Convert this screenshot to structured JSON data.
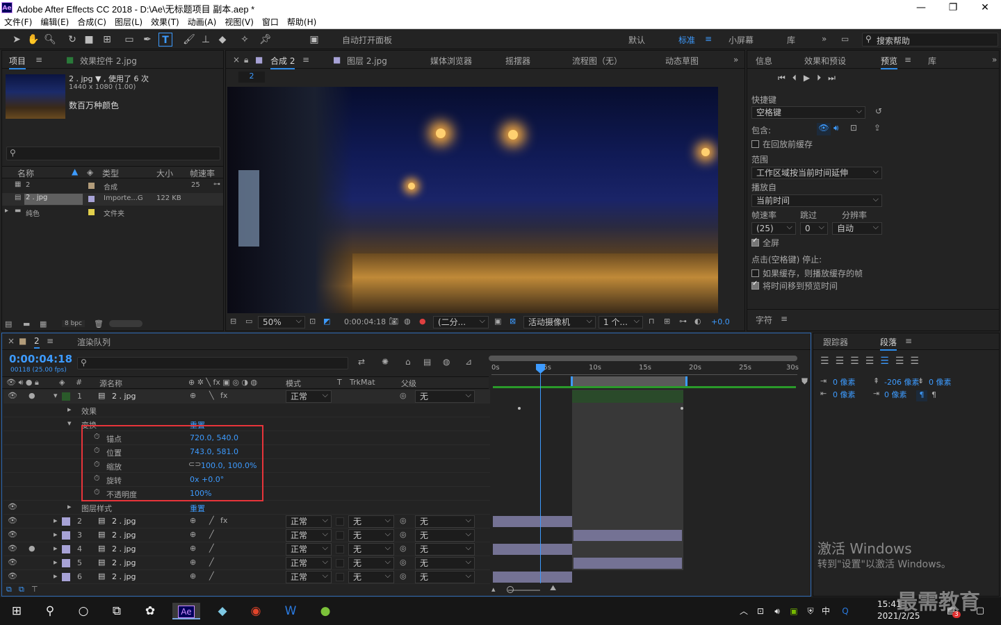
{
  "window": {
    "title": "Adobe After Effects CC 2018 - D:\\Ae\\无标题项目 副本.aep *",
    "app_icon": "Ae"
  },
  "menu": [
    "文件(F)",
    "编辑(E)",
    "合成(C)",
    "图层(L)",
    "效果(T)",
    "动画(A)",
    "视图(V)",
    "窗口",
    "帮助(H)"
  ],
  "toolbar": {
    "auto_open": "自动打开面板",
    "workspaces": [
      "默认",
      "标准",
      "小屏幕",
      "库"
    ],
    "search_placeholder": "搜索帮助"
  },
  "project": {
    "tab1": "项目",
    "tab2": "效果控件 2.jpg",
    "file": "2 . jpg ▼ , 使用了 6 次",
    "dims": "1440 x 1080 (1.00)",
    "colors": "数百万种颜色",
    "headers": [
      "名称",
      "类型",
      "大小",
      "帧速率"
    ],
    "items": [
      {
        "name": "2",
        "type": "合成",
        "size": "",
        "fps": "25"
      },
      {
        "name": "2 . jpg",
        "type": "Importe...G",
        "size": "122 KB",
        "fps": ""
      },
      {
        "name": "纯色",
        "type": "文件夹",
        "size": "",
        "fps": ""
      }
    ],
    "bpc": "8 bpc"
  },
  "viewer": {
    "tabs": [
      "合成 2",
      "图层 2.jpg",
      "媒体浏览器",
      "摇摆器",
      "流程图（无）",
      "动态草图"
    ],
    "crumb": "2",
    "zoom": "50%",
    "time": "0:00:04:18",
    "res": "(二分...",
    "camera": "活动摄像机",
    "views": "1 个...",
    "exposure": "+0.0"
  },
  "preview": {
    "tabs": [
      "信息",
      "效果和预设",
      "预览",
      "库"
    ],
    "shortcut_label": "快捷键",
    "shortcut": "空格键",
    "include": "包含:",
    "cache_before": "在回放前缓存",
    "range_label": "范围",
    "range": "工作区域按当前时间延伸",
    "play_from_label": "播放自",
    "play_from": "当前时间",
    "fps_label": "帧速率",
    "skip_label": "跳过",
    "res_label": "分辨率",
    "fps": "(25)",
    "skip": "0",
    "res": "自动",
    "fullscreen": "全屏",
    "stop_label": "点击(空格键) 停止:",
    "if_cached": "如果缓存，则播放缓存的帧",
    "move_time": "将时间移到预览时间",
    "char_tab": "字符"
  },
  "timeline": {
    "tab": "2",
    "render_queue": "渲染队列",
    "timecode": "0:00:04:18",
    "frames": "00118 (25.00 fps)",
    "headers": {
      "source": "源名称",
      "mode": "模式",
      "t": "T",
      "trkmat": "TrkMat",
      "parent": "父级"
    },
    "ruler": [
      "0s",
      "05s",
      "10s",
      "15s",
      "20s",
      "25s",
      "30s"
    ],
    "layer1": {
      "num": "1",
      "name": "2 . jpg",
      "mode": "正常",
      "parent": "无"
    },
    "effects": "效果",
    "transform": "变换",
    "reset": "重置",
    "props": [
      {
        "name": "锚点",
        "value": "720.0, 540.0"
      },
      {
        "name": "位置",
        "value": "743.0, 581.0"
      },
      {
        "name": "缩放",
        "value": "100.0, 100.0%"
      },
      {
        "name": "旋转",
        "value": "0x +0.0°"
      },
      {
        "name": "不透明度",
        "value": "100%"
      }
    ],
    "layer_styles": "图层样式",
    "reset2": "重置",
    "layers": [
      {
        "num": "2",
        "name": "2 . jpg",
        "mode": "正常",
        "trk": "无",
        "parent": "无"
      },
      {
        "num": "3",
        "name": "2 . jpg",
        "mode": "正常",
        "trk": "无",
        "parent": "无"
      },
      {
        "num": "4",
        "name": "2 . jpg",
        "mode": "正常",
        "trk": "无",
        "parent": "无"
      },
      {
        "num": "5",
        "name": "2 . jpg",
        "mode": "正常",
        "trk": "无",
        "parent": "无"
      },
      {
        "num": "6",
        "name": "2 . jpg",
        "mode": "正常",
        "trk": "无",
        "parent": "无"
      }
    ]
  },
  "paragraph": {
    "tabs": [
      "跟踪器",
      "段落"
    ],
    "indent_left": "0 像素",
    "indent_right": "0 像素",
    "first_indent": "-206 像素",
    "space_before": "0 像素",
    "space_after": "0 像素"
  },
  "watermark": {
    "line1": "激活 Windows",
    "line2": "转到\"设置\"以激活 Windows。",
    "brand": "最需教育"
  },
  "taskbar": {
    "time": "15:41",
    "date": "2021/2/25",
    "ime": "中",
    "notif": "3"
  }
}
